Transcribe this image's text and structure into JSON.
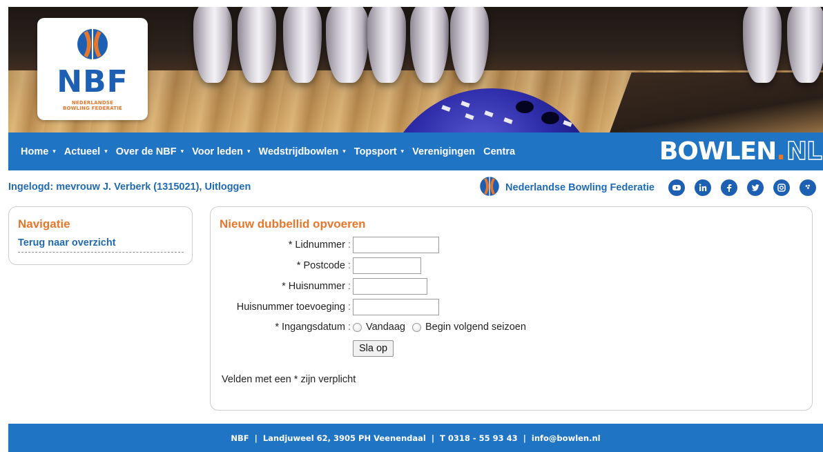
{
  "brand": {
    "logo_text": "NBF",
    "logo_sub_line1": "NEDERLANDSE",
    "logo_sub_line2": "BOWLING FEDERATIE",
    "wordmark_main": "BOWLEN",
    "wordmark_dot": ".",
    "wordmark_nl": "NL",
    "primary_color": "#2074c4",
    "accent_color": "#e8762b"
  },
  "nav": {
    "items": [
      {
        "label": "Home",
        "has_dropdown": true
      },
      {
        "label": "Actueel",
        "has_dropdown": true
      },
      {
        "label": "Over de NBF",
        "has_dropdown": true
      },
      {
        "label": "Voor leden",
        "has_dropdown": true
      },
      {
        "label": "Wedstrijdbowlen",
        "has_dropdown": true
      },
      {
        "label": "Topsport",
        "has_dropdown": true
      },
      {
        "label": "Verenigingen",
        "has_dropdown": false
      },
      {
        "label": "Centra",
        "has_dropdown": false
      }
    ],
    "caret": "▾"
  },
  "subheader": {
    "login_prefix": "Ingelogd: mevrouw J. Verberk (1315021), ",
    "logout_label": "Uitloggen",
    "federation_name": "Nederlandse Bowling Federatie",
    "social_icons": [
      "youtube-icon",
      "linkedin-icon",
      "facebook-icon",
      "twitter-icon",
      "instagram-icon",
      "bowling-ball-icon"
    ]
  },
  "sidebar": {
    "title": "Navigatie",
    "back_link": "Terug naar overzicht"
  },
  "form": {
    "title": "Nieuw dubbellid opvoeren",
    "fields": [
      {
        "label": "* Lidnummer",
        "value": ""
      },
      {
        "label": "* Postcode",
        "value": ""
      },
      {
        "label": "* Huisnummer",
        "value": ""
      },
      {
        "label": "Huisnummer toevoeging",
        "value": ""
      }
    ],
    "colon": " :",
    "date_label": "* Ingangsdatum",
    "date_options": [
      "Vandaag",
      "Begin volgend seizoen"
    ],
    "save_label": "Sla op",
    "required_note": "Velden met een * zijn verplicht"
  },
  "footer": {
    "text": "NBF  |  Landjuweel 62, 3905 PH Veenendaal  |  T 0318 - 55 93 43  |  info@bowlen.nl"
  }
}
